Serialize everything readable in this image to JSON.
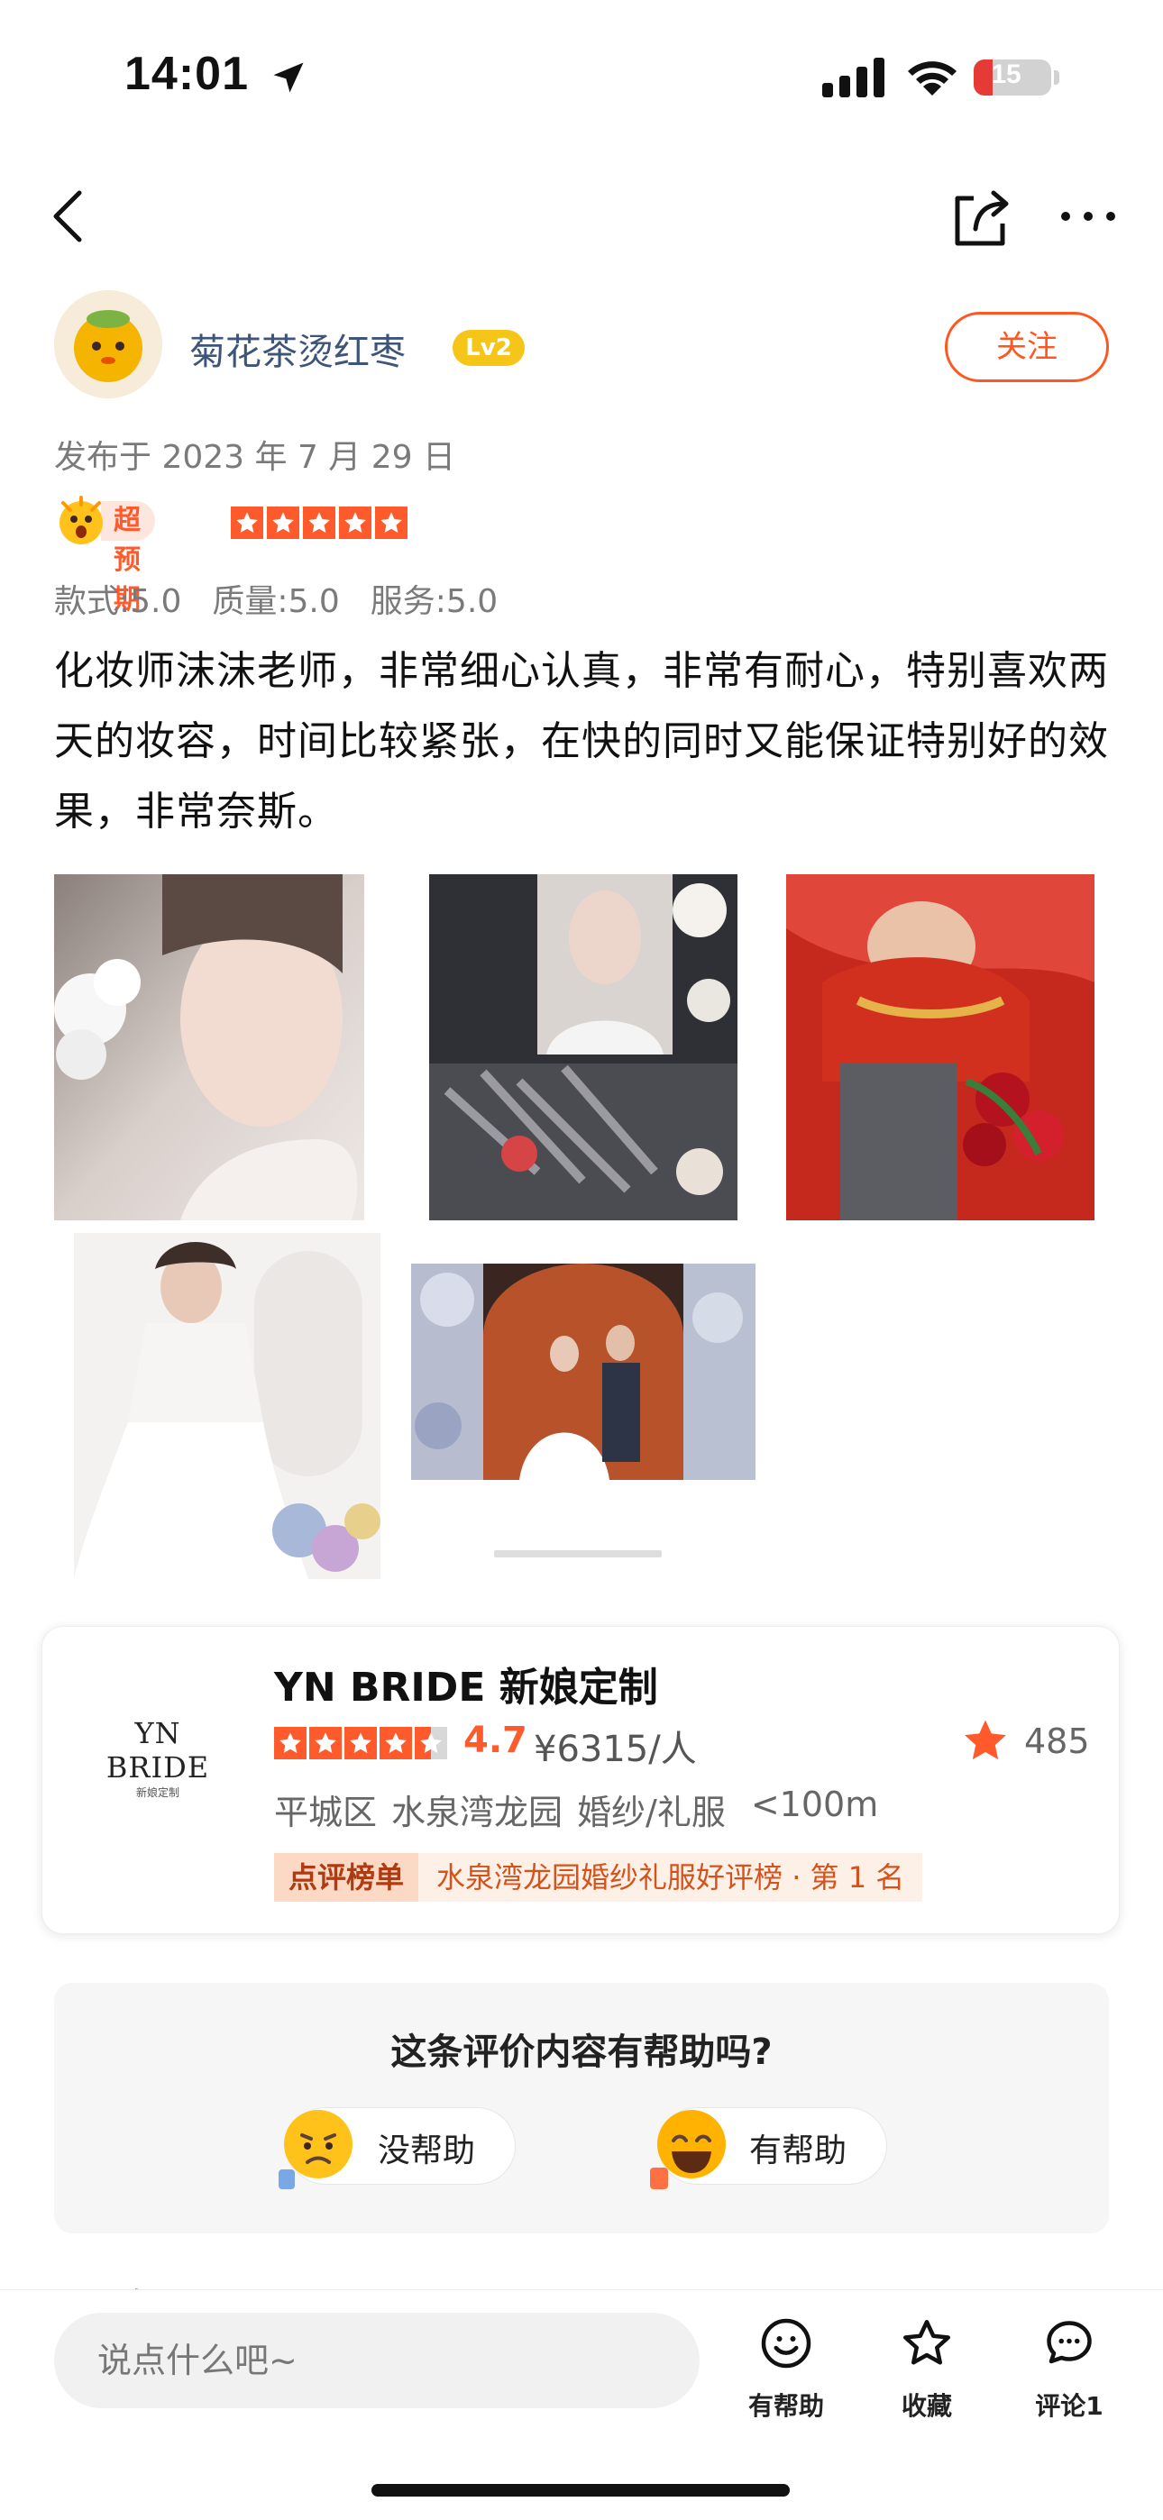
{
  "status_bar": {
    "time": "14:01",
    "battery": "15"
  },
  "author": {
    "name": "菊花茶烫红枣",
    "level": "Lv2",
    "follow_label": "关注"
  },
  "publish_date": "发布于 2023 年 7 月 29 日",
  "rating": {
    "label": "超预期",
    "stars": 5
  },
  "scores": [
    "款式:5.0",
    "质量:5.0",
    "服务:5.0"
  ],
  "review_text": "化妆师沫沫老师，非常细心认真，非常有耐心，特别喜欢两天的妆容，时间比较紧张，在快的同时又能保证特别好的效果，非常奈斯。",
  "photos": [
    {
      "desc": "bride-profile"
    },
    {
      "desc": "makeup-brushes"
    },
    {
      "desc": "red-dress-bride"
    },
    {
      "desc": "white-gown-bride"
    },
    {
      "desc": "couple-flower-arch"
    }
  ],
  "shop": {
    "logo_main": "YN BRIDE",
    "logo_sub": "新娘定制",
    "name": "YN BRIDE 新娘定制",
    "score": "4.7",
    "price": "¥6315/人",
    "favorites": "485",
    "district": "平城区",
    "area": "水泉湾龙园",
    "category": "婚纱/礼服",
    "distance": "<100m",
    "rank_label": "点评榜单",
    "rank_text": "水泉湾龙园婚纱礼服好评榜 · 第 1 名"
  },
  "helpful": {
    "question": "这条评价内容有帮助吗?",
    "no_label": "没帮助",
    "yes_label": "有帮助"
  },
  "comments_title": "评论",
  "bottom_bar": {
    "input_placeholder": "说点什么吧~",
    "helpful": "有帮助",
    "favorite": "收藏",
    "comment": "评论1"
  }
}
